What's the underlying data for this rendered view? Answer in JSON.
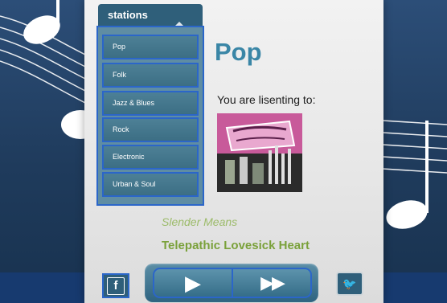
{
  "stations": {
    "title": "stations",
    "items": [
      "Pop",
      "Folk",
      "Jazz & Blues",
      "Rock",
      "Electronic",
      "Urban & Soul"
    ]
  },
  "now_playing": {
    "genre": "Pop",
    "listening_label": "You are lisenting to:",
    "artist": "Slender Means",
    "song": "Telepathic Lovesick Heart"
  },
  "controls": {
    "facebook_label": "f",
    "play_symbol": "▶",
    "forward_symbol": "▶▶",
    "twitter_symbol": "🐦"
  },
  "colors": {
    "accent": "#3a86a6",
    "song_green": "#7aa13a",
    "artist_green": "#9cbb6a",
    "selection_blue": "#2b66c9",
    "station_teal": "#4d8096"
  },
  "icons": [
    "music-note-icon",
    "play-icon",
    "fast-forward-icon",
    "facebook-icon",
    "twitter-icon"
  ]
}
